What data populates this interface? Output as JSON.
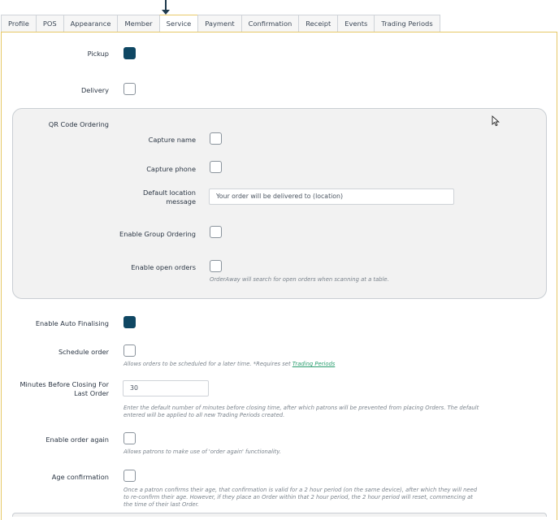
{
  "tabs": [
    {
      "label": "Profile"
    },
    {
      "label": "POS"
    },
    {
      "label": "Appearance"
    },
    {
      "label": "Member"
    },
    {
      "label": "Service"
    },
    {
      "label": "Payment"
    },
    {
      "label": "Confirmation"
    },
    {
      "label": "Receipt"
    },
    {
      "label": "Events"
    },
    {
      "label": "Trading Periods"
    }
  ],
  "active_tab": "Service",
  "service": {
    "pickup": {
      "label": "Pickup",
      "checked": true
    },
    "delivery": {
      "label": "Delivery",
      "checked": false
    },
    "qr": {
      "title": "QR Code Ordering",
      "capture_name": {
        "label": "Capture name",
        "checked": false
      },
      "capture_phone": {
        "label": "Capture phone",
        "checked": false
      },
      "default_location": {
        "label_line1": "Default location",
        "label_line2": "message",
        "placeholder": "Your order will be delivered to (location)",
        "value": ""
      },
      "group_ordering": {
        "label": "Enable Group Ordering",
        "checked": false
      },
      "open_orders": {
        "label": "Enable open orders",
        "checked": false,
        "help": "OrderAway will search for open orders when scanning at a table."
      }
    },
    "auto_finalising": {
      "label": "Enable Auto Finalising",
      "checked": true
    },
    "schedule_order": {
      "label": "Schedule order",
      "checked": false,
      "help_prefix": "Allows orders to be scheduled for a later time. *Requires set ",
      "help_link": "Trading Periods"
    },
    "minutes_before_closing": {
      "label_line1": "Minutes Before Closing For",
      "label_line2": "Last Order",
      "value": "30",
      "help_line1": "Enter the default number of minutes before closing time, after which patrons will be prevented from placing Orders. The default",
      "help_line2": "entered will be applied to all new Trading Periods created."
    },
    "order_again": {
      "label": "Enable order again",
      "checked": false,
      "help": "Allows patrons to make use of 'order again' functionality."
    },
    "age_confirmation": {
      "label": "Age confirmation",
      "checked": false,
      "help_line1": "Once a patron confirms their age, that confirmation is valid for a 2 hour period (on the same device), after which they will need",
      "help_line2": "to re-confirm their age. However, if they place an Order within that 2 hour period, the 2 hour period will reset, commencing at",
      "help_line3": "the time of their last Order."
    }
  },
  "colors": {
    "checked": "#0f4763",
    "active_tab_border": "#e6c866",
    "link": "#2a9d6f"
  }
}
